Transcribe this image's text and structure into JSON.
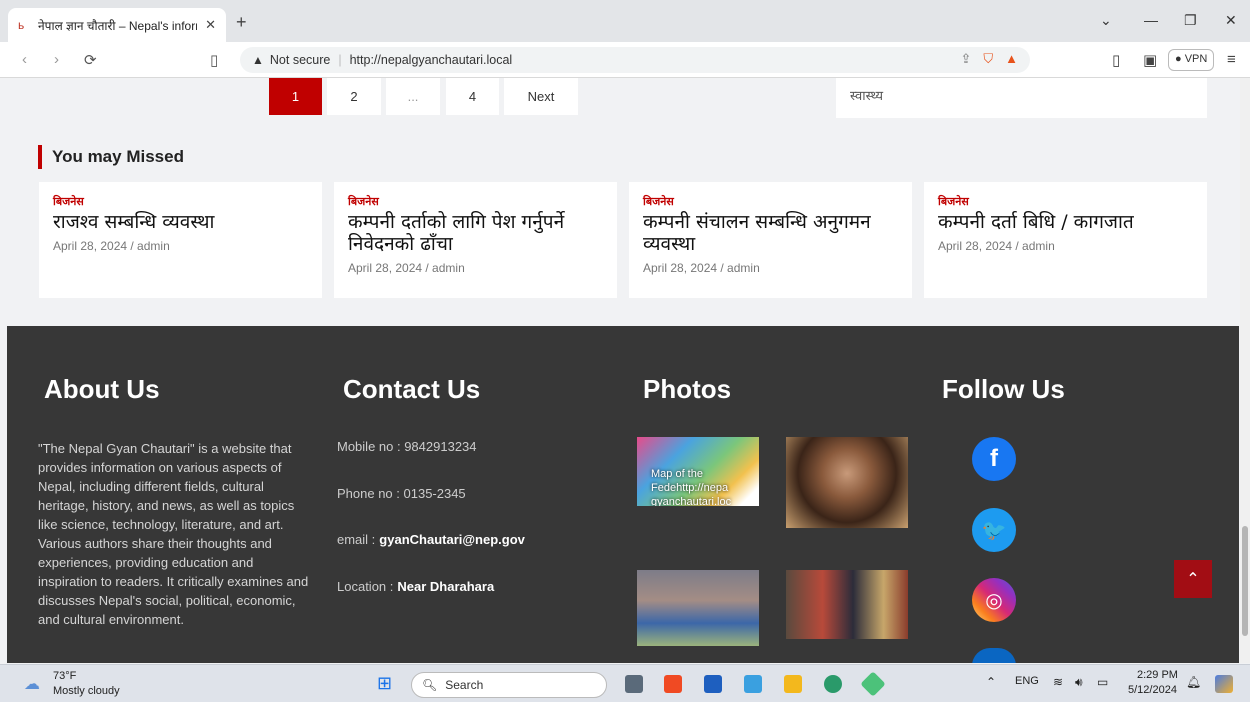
{
  "browser": {
    "tab_title": "नेपाल ज्ञान चौतारी – Nepal's inform",
    "new_tab": "+",
    "security": "Not secure",
    "url": "http://nepalgyanchautari.local",
    "vpn": "VPN"
  },
  "pagination": {
    "pages": [
      "1",
      "2",
      "...",
      "4",
      "Next"
    ],
    "active": "1"
  },
  "sidebar_tag": "स्वास्थ्य",
  "you_may_missed": {
    "title": "You may Missed",
    "cards": [
      {
        "category": "बिजनेस",
        "headline": "राजश्व सम्बन्धि व्यवस्था",
        "meta": "April 28, 2024 / admin"
      },
      {
        "category": "बिजनेस",
        "headline": "कम्पनी दर्ताको लागि पेश गर्नुपर्ने निवेदनको ढाँचा",
        "meta": "April 28, 2024 / admin"
      },
      {
        "category": "बिजनेस",
        "headline": " कम्पनी संचालन सम्बन्धि अनुगमन व्यवस्था",
        "meta": "April 28, 2024 / admin"
      },
      {
        "category": "बिजनेस",
        "headline": " कम्पनी दर्ता बिधि / कागजात",
        "meta": "April 28, 2024 / admin"
      }
    ]
  },
  "footer": {
    "about_title": "About Us",
    "about_text": "\"The Nepal Gyan Chautari\" is a website that provides information on various aspects of Nepal, including different fields, cultural heritage, history, and news, as well as topics like science, technology, literature, and art. Various authors share their thoughts and experiences, providing education and inspiration to readers. It critically examines and discusses Nepal's social, political, economic, and cultural environment.",
    "contact_title": "Contact Us",
    "mobile": "Mobile no : 9842913234",
    "phone": "Phone no : 0135-2345",
    "email_label": "email :",
    "email_value": "gyanChautari@nep.gov",
    "location_label": "Location :",
    "location_value": "Near Dharahara",
    "photos_title": "Photos",
    "photo_caption": "Map of the Fedehttp://nepa gyanchautari.loc",
    "follow_title": "Follow Us"
  },
  "taskbar": {
    "temp": "73°F",
    "weather": "Mostly cloudy",
    "search": "Search",
    "lang": "ENG",
    "time": "2:29 PM",
    "date": "5/12/2024"
  },
  "colors": {
    "accent": "#c00000",
    "footer_bg": "#373737",
    "facebook": "#1877f2",
    "twitter": "#1d9bf0",
    "instagram": "#d6249f"
  }
}
